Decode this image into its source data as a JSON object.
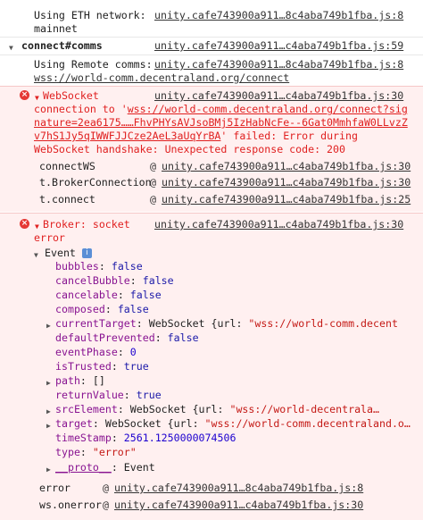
{
  "top_log": {
    "text_line1": "Using ETH network:",
    "text_line2": "mainnet",
    "source": "unity.cafe743900a911…8c4aba749b1fba.js:8"
  },
  "group": {
    "label": "connect#comms",
    "source": "unity.cafe743900a911…c4aba749b1fba.js:59"
  },
  "remote_log": {
    "text_line1": "Using Remote comms:",
    "text_line2": "wss://world-comm.decentraland.org/connect",
    "source": "unity.cafe743900a911…8c4aba749b1fba.js:8"
  },
  "ws_error": {
    "title": "WebSocket",
    "source": "unity.cafe743900a911…c4aba749b1fba.js:30",
    "line2_a": "connection to '",
    "line2_link": "wss://world-comm.decentraland.org/connect?sig",
    "line3_link": "nature=2ea6175……FhvPHYsAVJsoBMj5IzHabNcFe--6Gat0MmhfaW0LLvzZ",
    "line4_link": "v7hS1Jy5qIWWFJJCze2AeL3aUqYrBA",
    "line4_rest": "' failed: Error during",
    "line5": "WebSocket handshake: Unexpected response code: 200",
    "stack": [
      {
        "fn": "connectWS",
        "src": "unity.cafe743900a911…c4aba749b1fba.js:30"
      },
      {
        "fn": "t.BrokerConnection",
        "src": "unity.cafe743900a911…c4aba749b1fba.js:30"
      },
      {
        "fn": "t.connect",
        "src": "unity.cafe743900a911…c4aba749b1fba.js:25"
      }
    ]
  },
  "broker_error": {
    "title_line1": "Broker: socket",
    "title_line2": "error",
    "source": "unity.cafe743900a911…c4aba749b1fba.js:30",
    "event_label": "Event",
    "info_glyph": "i",
    "props": {
      "bubbles": {
        "k": "bubbles",
        "v": "false"
      },
      "cancelBubble": {
        "k": "cancelBubble",
        "v": "false"
      },
      "cancelable": {
        "k": "cancelable",
        "v": "false"
      },
      "composed": {
        "k": "composed",
        "v": "false"
      },
      "currentTarget": {
        "k": "currentTarget",
        "v1": "WebSocket {url: ",
        "v2": "\"wss://world-comm.decent"
      },
      "defaultPrevented": {
        "k": "defaultPrevented",
        "v": "false"
      },
      "eventPhase": {
        "k": "eventPhase",
        "v": "0"
      },
      "isTrusted": {
        "k": "isTrusted",
        "v": "true"
      },
      "path": {
        "k": "path",
        "v": "[]"
      },
      "returnValue": {
        "k": "returnValue",
        "v": "true"
      },
      "srcElement": {
        "k": "srcElement",
        "v1": "WebSocket {url: ",
        "v2": "\"wss://world-decentrala…"
      },
      "target": {
        "k": "target",
        "v1": "WebSocket {url: ",
        "v2": "\"wss://world-comm.decentraland.o…"
      },
      "timeStamp": {
        "k": "timeStamp",
        "v": "2561.1250000074506"
      },
      "type": {
        "k": "type",
        "v": "\"error\""
      },
      "proto": {
        "k": "__proto__",
        "v": "Event"
      }
    },
    "stack": [
      {
        "fn": "error",
        "src": "unity.cafe743900a911…8c4aba749b1fba.js:8"
      },
      {
        "fn": "ws.onerror",
        "src": "unity.cafe743900a911…c4aba749b1fba.js:30"
      }
    ]
  },
  "colors": {
    "error_red": "#e02020",
    "error_bg": "#fff0f0",
    "key_purple": "#881391",
    "bool_blue": "#1c1aa9"
  }
}
